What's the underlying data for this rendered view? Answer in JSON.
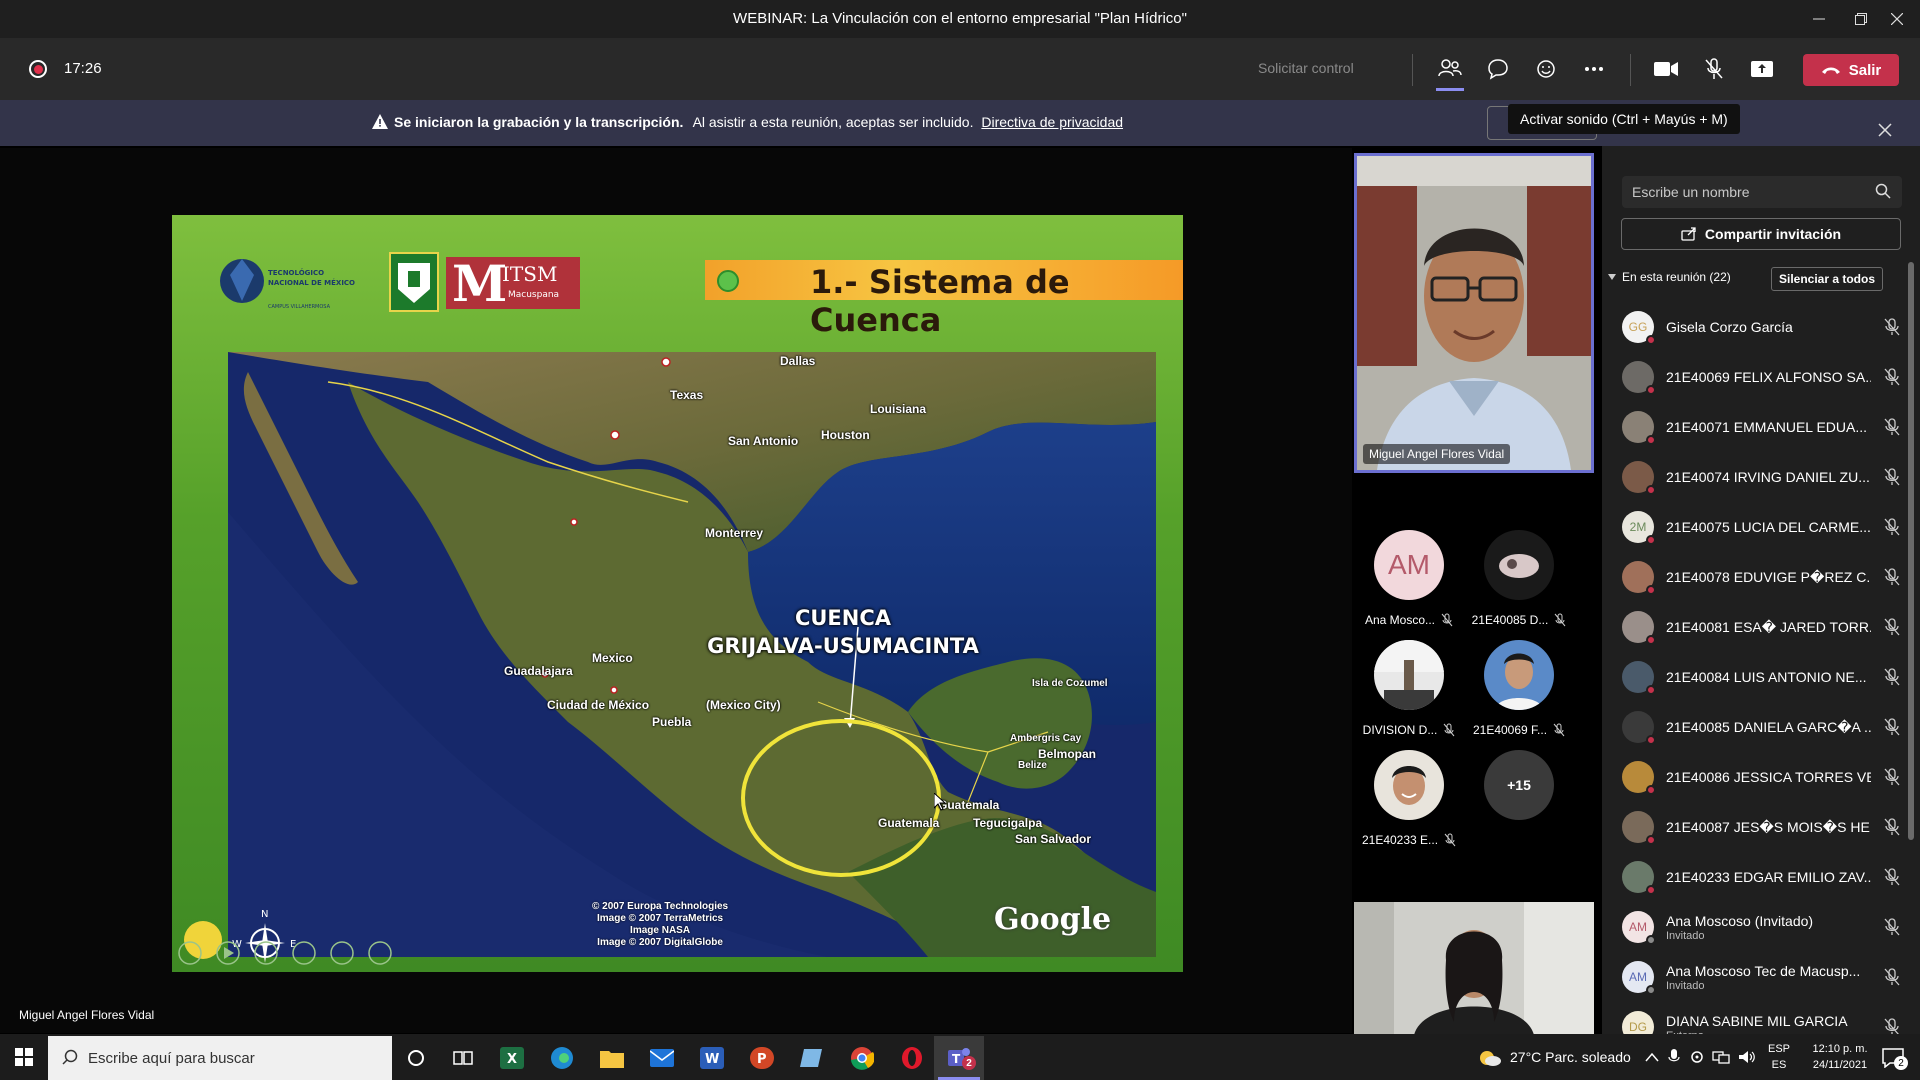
{
  "window": {
    "title": "WEBINAR: La Vinculación con el entorno empresarial \"Plan Hídrico\""
  },
  "toolbar": {
    "timer": "17:26",
    "request_control": "Solicitar control",
    "leave_label": "Salir",
    "leave_color": "#c4314b"
  },
  "banner": {
    "bold_text": "Se iniciaron la grabación y la transcripción.",
    "text": "Al asistir a esta reunión, aceptas ser incluido.",
    "link": "Directiva de privacidad",
    "tooltip": "Activar sonido (Ctrl + Mayús + M)"
  },
  "stage": {
    "presenter_name": "Miguel Angel Flores Vidal"
  },
  "slide": {
    "title": "1.- Sistema de Cuenca",
    "logo_itsm": "ITSM",
    "logo_itsm_sub": "Macuspana",
    "logo_tec_line1": "TECNOLÓGICO",
    "logo_tec_line2": "NACIONAL DE MÉXICO",
    "logo_tec_line3": "CAMPUS VILLAHERMOSA",
    "cuenca_line1": "CUENCA",
    "cuenca_line2": "GRIJALVA-USUMACINTA",
    "labels": {
      "dallas": "Dallas",
      "texas": "Texas",
      "louisiana": "Louisiana",
      "houston": "Houston",
      "san_antonio": "San Antonio",
      "monterrey": "Monterrey",
      "mexico": "Mexico",
      "guadalajara": "Guadalajara",
      "ciudad_mexico": "Ciudad de México",
      "mexico_city": "(Mexico City)",
      "puebla": "Puebla",
      "isla_cozumel": "Isla de Cozumel",
      "ambergris": "Ambergris Cay",
      "belmopan": "Belmopan",
      "belize": "Belize",
      "guatemala": "Guatemala",
      "guatemala_city": "Guatemala",
      "tegucigalpa": "Tegucigalpa",
      "san_salvador": "San Salvador",
      "compass_n": "N",
      "compass_w": "W",
      "compass_e": "E"
    },
    "copyright": [
      "© 2007 Europa Technologies",
      "Image © 2007 TerraMetrics",
      "Image NASA",
      "Image © 2007 DigitalGlobe"
    ],
    "google": "Google"
  },
  "videos": {
    "main_name": "Miguel Angel Flores Vidal",
    "tiles": [
      {
        "initials": "AM",
        "name": "Ana Mosco..."
      },
      {
        "initials": "",
        "name": "21E40085 D..."
      },
      {
        "initials": "",
        "name": "DIVISION D..."
      },
      {
        "initials": "",
        "name": "21E40069 F..."
      },
      {
        "initials": "",
        "name": "21E40233 E..."
      },
      {
        "initials": "+15",
        "name": ""
      }
    ]
  },
  "panel": {
    "search_placeholder": "Escribe un nombre",
    "share_label": "Compartir invitación",
    "in_meeting": "En esta reunión (22)",
    "mute_all": "Silenciar a todos",
    "participants": [
      {
        "initials": "GG",
        "name": "Gisela Corzo García",
        "sub": "",
        "color": "#f2f2f2",
        "text": "#c7a25a"
      },
      {
        "initials": "",
        "name": "21E40069 FELIX ALFONSO SA...",
        "sub": "",
        "color": "#6d6a66"
      },
      {
        "initials": "",
        "name": "21E40071 EMMANUEL EDUA...",
        "sub": "",
        "color": "#8a8176"
      },
      {
        "initials": "",
        "name": "21E40074 IRVING DANIEL ZU...",
        "sub": "",
        "color": "#7b5a48"
      },
      {
        "initials": "2M",
        "name": "21E40075 LUCIA DEL CARME...",
        "sub": "",
        "color": "#e8e6dd",
        "text": "#6a8a5a"
      },
      {
        "initials": "",
        "name": "21E40078 EDUVIGE P�REZ C...",
        "sub": "",
        "color": "#a0705a"
      },
      {
        "initials": "",
        "name": "21E40081 ESA� JARED TORR...",
        "sub": "",
        "color": "#9a8f8a"
      },
      {
        "initials": "",
        "name": "21E40084 LUIS ANTONIO NE...",
        "sub": "",
        "color": "#4a5a6a"
      },
      {
        "initials": "",
        "name": "21E40085 DANIELA GARC�A ...",
        "sub": "",
        "color": "#3a3a3a"
      },
      {
        "initials": "",
        "name": "21E40086 JESSICA TORRES VE...",
        "sub": "",
        "color": "#b88a3a"
      },
      {
        "initials": "",
        "name": "21E40087 JES�S MOIS�S HE...",
        "sub": "",
        "color": "#7a6a5a"
      },
      {
        "initials": "",
        "name": "21E40233 EDGAR EMILIO ZAV...",
        "sub": "",
        "color": "#6a7a6a"
      },
      {
        "initials": "AM",
        "name": "Ana Moscoso (Invitado)",
        "sub": "Invitado",
        "color": "#f2e4e4",
        "text": "#b45a6a"
      },
      {
        "initials": "AM",
        "name": "Ana Moscoso Tec de Macusp...",
        "sub": "Invitado",
        "color": "#e4e8f2",
        "text": "#5a6ab4"
      },
      {
        "initials": "DG",
        "name": "DIANA SABINE MIL GARCIA",
        "sub": "Externo",
        "color": "#f2ecd8",
        "text": "#b49a4a"
      }
    ]
  },
  "taskbar": {
    "search_placeholder": "Escribe aquí para buscar",
    "weather": "27°C  Parc. soleado",
    "lang1": "ESP",
    "lang2": "ES",
    "time": "12:10 p. m.",
    "date": "24/11/2021",
    "notif_count": "2",
    "teams_badge": "2"
  }
}
